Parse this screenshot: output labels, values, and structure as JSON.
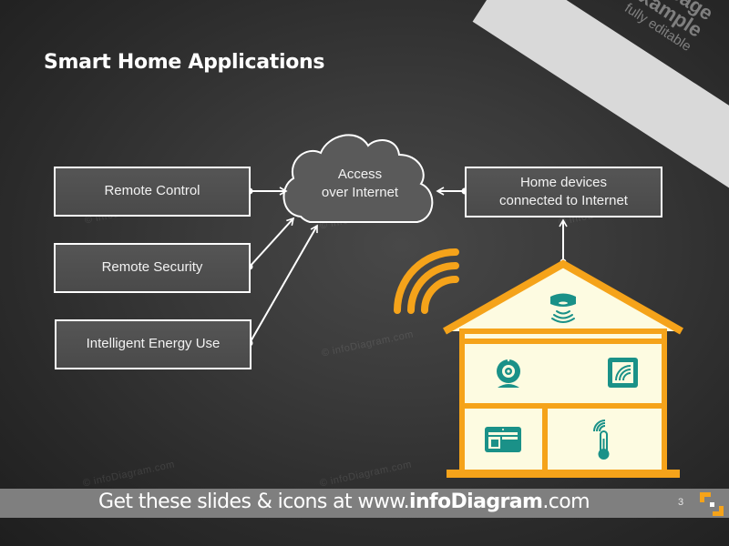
{
  "slide": {
    "title": "Smart Home Applications",
    "banner": {
      "line1": "Usage",
      "line2": "example",
      "line3": "fully editable"
    },
    "colors": {
      "accent_orange": "#f5a31a",
      "house_fill": "#fdfbe1",
      "icon_teal": "#1a9188",
      "box_border": "#ffffff",
      "footer_bg": "#7f7f7f"
    }
  },
  "diagram": {
    "left_boxes": [
      {
        "label": "Remote Control"
      },
      {
        "label": "Remote Security"
      },
      {
        "label": "Intelligent Energy Use"
      }
    ],
    "cloud": {
      "line1": "Access",
      "line2": "over Internet"
    },
    "right_box": {
      "line1": "Home devices",
      "line2": "connected to Internet"
    },
    "house": {
      "icons": [
        {
          "name": "smoke-detector-icon",
          "room": "attic"
        },
        {
          "name": "webcam-icon",
          "room": "middle-left"
        },
        {
          "name": "wireless-tablet-icon",
          "room": "middle-right"
        },
        {
          "name": "control-panel-icon",
          "room": "bottom-left"
        },
        {
          "name": "smart-thermometer-icon",
          "room": "bottom-right"
        }
      ]
    }
  },
  "watermarks": [
    "© infoDiagram.com",
    "© infoDiagram.com",
    "© infoDiagram.com",
    "© infoDiagram.com",
    "© infoDiagram.com",
    "© infoDiagram.com"
  ],
  "footer": {
    "prefix": "Get these slides & icons at www.",
    "brand": "infoDiagram",
    "suffix": ".com",
    "page_number": "3"
  }
}
